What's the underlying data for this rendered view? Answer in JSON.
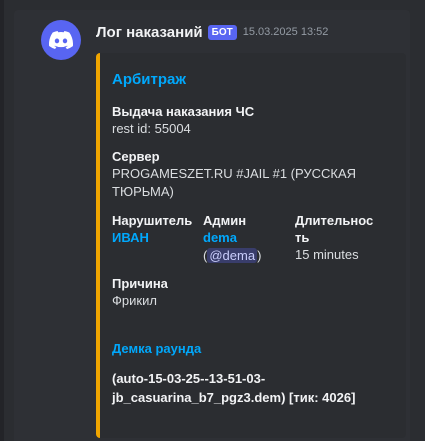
{
  "message": {
    "username": "Лог наказаний",
    "bot_tag": "БОТ",
    "timestamp": "15.03.2025 13:52"
  },
  "embed": {
    "accent_color": "#f0a500",
    "title": "Арбитраж",
    "ban_issue": {
      "name": "Выдача наказания ЧС",
      "value": "rest id: 55004"
    },
    "server": {
      "name": "Сервер",
      "line1": "PROGAMESZET.RU #JAIL #1 (РУССКАЯ",
      "line2": "ТЮРЬМА)"
    },
    "violator": {
      "name": "Нарушитель",
      "value": "ИВАН"
    },
    "admin": {
      "name": "Админ",
      "value": "dema",
      "open": "(",
      "mention": "@dema",
      "close": ")"
    },
    "duration": {
      "name_line1": "Длительнос",
      "name_line2": "ть",
      "value": "15 minutes"
    },
    "reason": {
      "name": "Причина",
      "value": "Фрикил"
    },
    "demo": {
      "link": "Демка раунда",
      "line1": "(auto-15-03-25--13-51-03-",
      "line2": "jb_casuarina_b7_pgz3.dem) [тик: 4026]"
    }
  }
}
